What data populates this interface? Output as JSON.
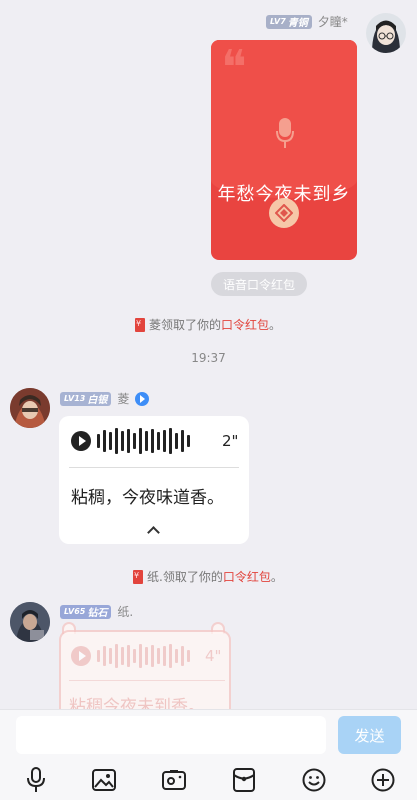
{
  "top_sender": {
    "level": "LV7",
    "rank": "青铜",
    "nickname": "夕瞳*"
  },
  "red_packet": {
    "text": "年愁今夜未到乡",
    "type_label": "语音口令红包"
  },
  "sys_msg_1": {
    "prefix": "菱领取了你的",
    "link": "口令红包",
    "suffix": "。"
  },
  "time_divider": "19:37",
  "sender_2": {
    "level": "LV13",
    "rank": "白银",
    "nickname": "菱"
  },
  "voice_msg_1": {
    "duration": "2\"",
    "text": "粘稠，今夜味道香。"
  },
  "sys_msg_2": {
    "prefix": "纸.领取了你的",
    "link": "口令红包",
    "suffix": "。"
  },
  "sender_3": {
    "level": "LV65",
    "rank": "钻石",
    "nickname": "纸."
  },
  "voice_msg_2": {
    "duration": "4\"",
    "text": "粘稠今夜未到香。"
  },
  "input_bar": {
    "placeholder": "",
    "send_label": "发送"
  },
  "toolbar": [
    "microphone-icon",
    "image-icon",
    "camera-icon",
    "red-packet-icon",
    "emoji-icon",
    "plus-icon"
  ],
  "colors": {
    "red": "#e94440",
    "send_button": "#a9d3f6",
    "background": "#efeef3"
  }
}
